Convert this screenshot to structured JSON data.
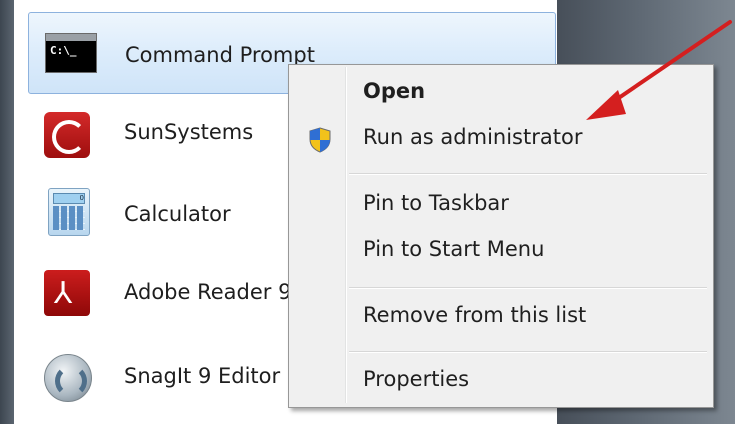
{
  "start_menu": {
    "items": [
      {
        "label": "Command Prompt",
        "icon": "command-prompt-icon",
        "icon_text": "C:\\_",
        "selected": true
      },
      {
        "label": "SunSystems",
        "icon": "sunsystems-icon"
      },
      {
        "label": "Calculator",
        "icon": "calculator-icon",
        "icon_text": "0"
      },
      {
        "label": "Adobe Reader 9",
        "icon": "adobe-reader-icon"
      },
      {
        "label": "SnagIt 9 Editor",
        "icon": "snagit-icon"
      }
    ]
  },
  "context_menu": {
    "items": [
      {
        "label": "Open",
        "bold": true
      },
      {
        "label": "Run as administrator",
        "icon": "uac-shield-icon"
      },
      {
        "label": "Pin to Taskbar"
      },
      {
        "label": "Pin to Start Menu"
      },
      {
        "label": "Remove from this list"
      },
      {
        "label": "Properties"
      }
    ]
  },
  "annotation": {
    "type": "arrow",
    "color": "#d41f1f"
  },
  "colors": {
    "selection_border": "#8db2de",
    "menu_background": "#f0f0f0",
    "desktop": "#5e6873"
  }
}
